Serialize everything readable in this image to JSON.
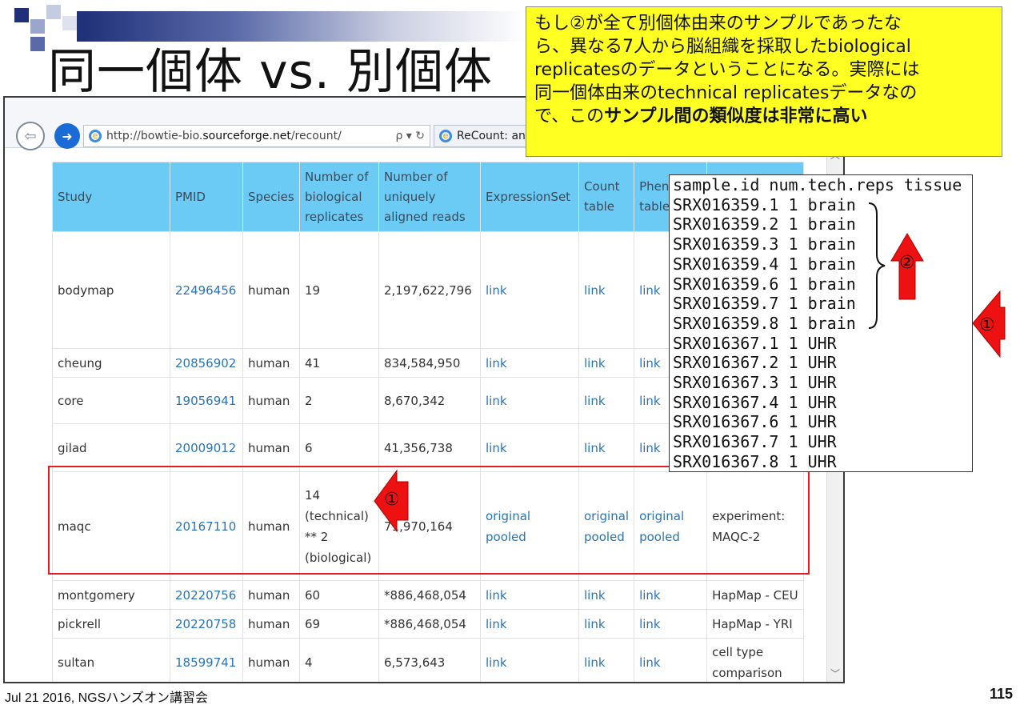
{
  "slide": {
    "title": "同一個体 vs. 別個体",
    "footer": "Jul 21 2016, NGSハンズオン講習会",
    "page_number": "115"
  },
  "browser": {
    "url_prefix": "http://bowtie-bio.",
    "url_host": "sourceforge.net",
    "url_path": "/recount/",
    "url_tools": "ρ ▾ ↻",
    "tab_label": "ReCount: an"
  },
  "table": {
    "headers": [
      "Study",
      "PMID",
      "Species",
      "Number of biological replicates",
      "Number of uniquely aligned reads",
      "ExpressionSet",
      "Count table",
      "Phen table",
      ""
    ],
    "rows": [
      {
        "study": "bodymap",
        "pmid": "22496456",
        "species": "human",
        "reps": "19",
        "reads": "2,197,622,796",
        "eset": "link",
        "count": "link",
        "phen": "link",
        "note": ""
      },
      {
        "study": "cheung",
        "pmid": "20856902",
        "species": "human",
        "reps": "41",
        "reads": "834,584,950",
        "eset": "link",
        "count": "link",
        "phen": "link",
        "note": ""
      },
      {
        "study": "core",
        "pmid": "19056941",
        "species": "human",
        "reps": "2",
        "reads": "8,670,342",
        "eset": "link",
        "count": "link",
        "phen": "link",
        "note": ""
      },
      {
        "study": "gilad",
        "pmid": "20009012",
        "species": "human",
        "reps": "6",
        "reads": "41,356,738",
        "eset": "link",
        "count": "link",
        "phen": "link",
        "note": ""
      },
      {
        "study": "maqc",
        "pmid": "20167110",
        "species": "human",
        "reps": "14 (technical) ** 2 (biological)",
        "reads": "71,970,164",
        "eset": "original pooled",
        "count": "original pooled",
        "phen": "original pooled",
        "note": "experiment: MAQC-2"
      },
      {
        "study": "montgomery",
        "pmid": "20220756",
        "species": "human",
        "reps": "60",
        "reads": "*886,468,054",
        "eset": "link",
        "count": "link",
        "phen": "link",
        "note": "HapMap - CEU"
      },
      {
        "study": "pickrell",
        "pmid": "20220758",
        "species": "human",
        "reps": "69",
        "reads": "*886,468,054",
        "eset": "link",
        "count": "link",
        "phen": "link",
        "note": "HapMap - YRI"
      },
      {
        "study": "sultan",
        "pmid": "18599741",
        "species": "human",
        "reps": "4",
        "reads": "6,573,643",
        "eset": "link",
        "count": "link",
        "phen": "link",
        "note": "cell type comparison"
      }
    ]
  },
  "callout": {
    "line1": "もし②が全て別個体由来のサンプルであったな",
    "line2": "ら、異なる7人から脳組織を採取したbiological",
    "line3": "replicatesのデータということになる。実際には",
    "line4": "同一個体由来のtechnical replicatesデータなの",
    "line5_plain": "で、この",
    "line5_bold": "サンプル間の類似度は非常に高い"
  },
  "samples": {
    "header": "sample.id num.tech.reps tissue",
    "lines": [
      "SRX016359.1 1 brain",
      "SRX016359.2 1 brain",
      "SRX016359.3 1 brain",
      "SRX016359.4 1 brain",
      "SRX016359.6 1 brain",
      "SRX016359.7 1 brain",
      "SRX016359.8 1 brain",
      "SRX016367.1 1 UHR",
      "SRX016367.2 1 UHR",
      "SRX016367.3 1 UHR",
      "SRX016367.4 1 UHR",
      "SRX016367.6 1 UHR",
      "SRX016367.7 1 UHR",
      "SRX016367.8 1 UHR"
    ]
  },
  "markers": {
    "one": "①",
    "two": "②"
  },
  "colors": {
    "header_bg": "#6ccbf5",
    "link": "#2a74b6",
    "callout_bg": "#ffff22",
    "highlight": "#e02020"
  }
}
